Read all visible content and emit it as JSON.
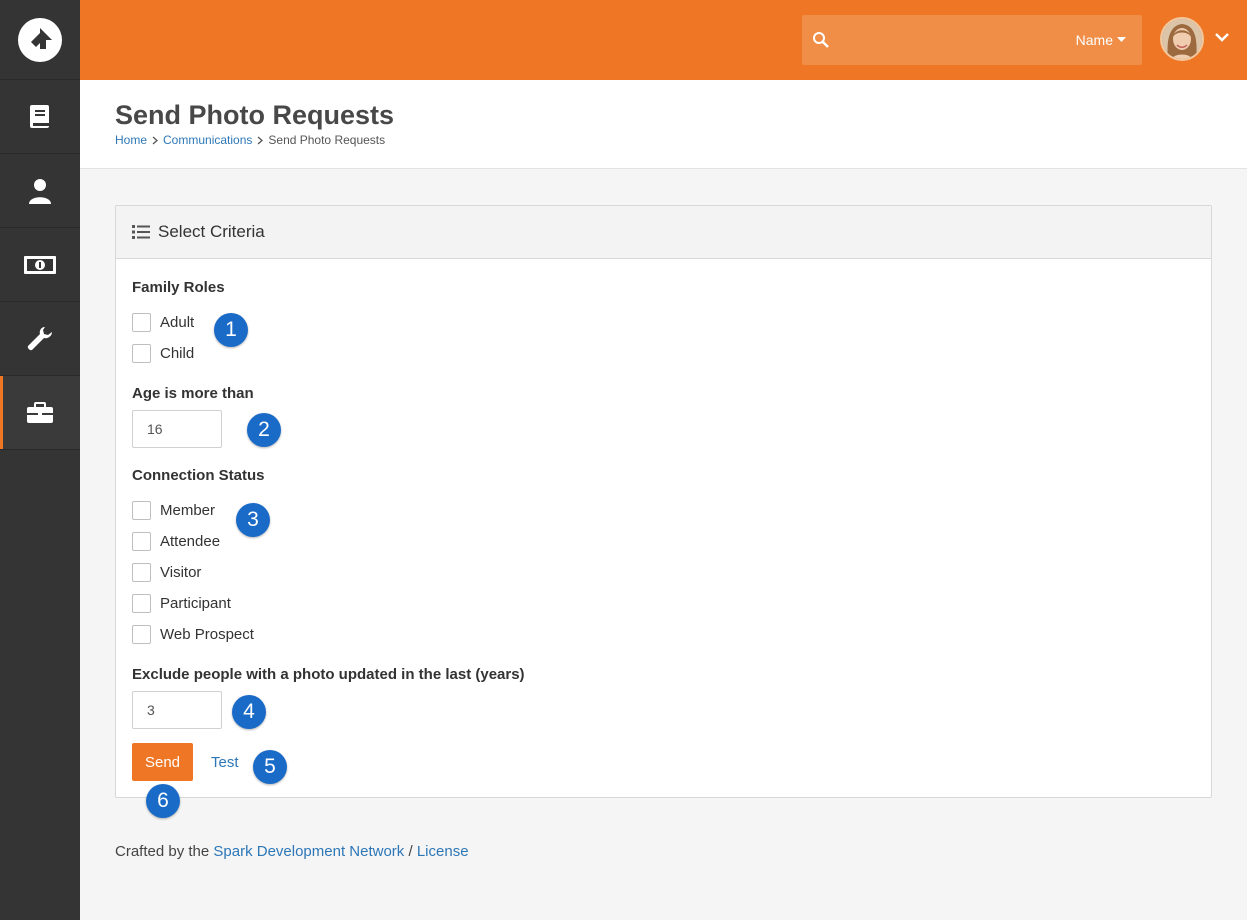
{
  "colors": {
    "accent": "#ee7625",
    "sidebar": "#343434",
    "link": "#2d77b7",
    "callout": "#1a6bc8"
  },
  "sidebar": {
    "logo_icon": "rock-logo-icon",
    "items": [
      {
        "icon": "book-icon"
      },
      {
        "icon": "person-icon"
      },
      {
        "icon": "money-icon"
      },
      {
        "icon": "wrench-icon"
      },
      {
        "icon": "briefcase-icon",
        "active": true
      }
    ]
  },
  "topbar": {
    "search": {
      "placeholder": "",
      "scope_label": "Name"
    }
  },
  "header": {
    "title": "Send Photo Requests",
    "breadcrumb": [
      "Home",
      "Communications",
      "Send Photo Requests"
    ]
  },
  "panel": {
    "title": "Select Criteria",
    "family_roles": {
      "label": "Family Roles",
      "options": [
        "Adult",
        "Child"
      ]
    },
    "age": {
      "label": "Age is more than",
      "value": "16"
    },
    "connection_status": {
      "label": "Connection Status",
      "options": [
        "Member",
        "Attendee",
        "Visitor",
        "Participant",
        "Web Prospect"
      ]
    },
    "exclude": {
      "label": "Exclude people with a photo updated in the last (years)",
      "value": "3"
    },
    "send_label": "Send",
    "test_label": "Test"
  },
  "callouts": [
    "1",
    "2",
    "3",
    "4",
    "5",
    "6"
  ],
  "footer": {
    "prefix": "Crafted by the",
    "link1": "Spark Development Network",
    "separator": "/",
    "link2": "License"
  }
}
